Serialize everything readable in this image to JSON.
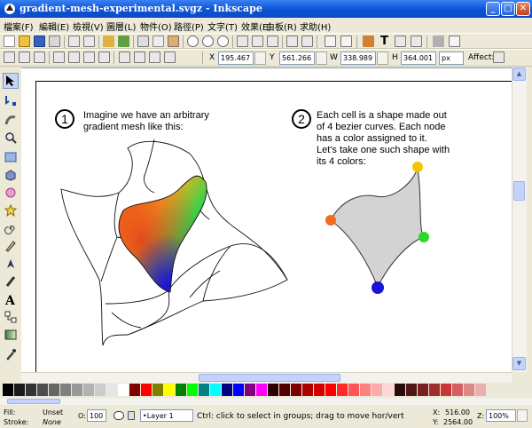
{
  "window": {
    "title": "gradient-mesh-experimental.svgz - Inkscape",
    "minimize_glyph": "_",
    "maximize_glyph": "□",
    "close_glyph": "✕"
  },
  "menu": [
    {
      "label": "檔案(F)"
    },
    {
      "label": "編輯(E)"
    },
    {
      "label": "檢視(V)"
    },
    {
      "label": "圖層(L)"
    },
    {
      "label": "物件(O)"
    },
    {
      "label": "路徑(P)"
    },
    {
      "label": "文字(T)"
    },
    {
      "label": "效果(E)"
    },
    {
      "label": "白板(R)"
    },
    {
      "label": "求助(H)"
    }
  ],
  "controls": {
    "x_label": "X",
    "x_value": "195.467",
    "y_label": "Y",
    "y_value": "561.266",
    "w_label": "W",
    "w_value": "338.989",
    "h_label": "H",
    "h_value": "364.001",
    "unit": "px",
    "affect_label": "Affect:"
  },
  "canvas": {
    "step1_number": "1",
    "step1_lines": [
      "Imagine we have an arbitrary",
      "gradient mesh like this:"
    ],
    "step2_number": "2",
    "step2_lines": [
      "Each cell is a shape made out",
      "of 4 bezier curves. Each node",
      "has a color assigned to it.",
      "Let's take one such shape with",
      "its 4 colors:"
    ],
    "node_colors": [
      "#f5c400",
      "#f26b1d",
      "#2ad82a",
      "#1a12d6"
    ]
  },
  "palette": [
    "#000000",
    "#1a1a1a",
    "#333333",
    "#4d4d4d",
    "#666666",
    "#808080",
    "#999999",
    "#b3b3b3",
    "#cccccc",
    "#e6e6e6",
    "#ffffff",
    "#800000",
    "#ff0000",
    "#808000",
    "#ffff00",
    "#008000",
    "#00ff00",
    "#008080",
    "#00ffff",
    "#000080",
    "#0000ff",
    "#800080",
    "#ff00ff",
    "#2b0000",
    "#550000",
    "#800000",
    "#aa0000",
    "#d40000",
    "#ff0000",
    "#ff2a2a",
    "#ff5555",
    "#ff8080",
    "#ffaaaa",
    "#ffd5d5",
    "#280b0b",
    "#501616",
    "#782121",
    "#a02c2c",
    "#c83737",
    "#d35f5f",
    "#de8787",
    "#e9afaf"
  ],
  "status": {
    "fill_label": "Fill:",
    "fill_value": "Unset",
    "stroke_label": "Stroke:",
    "stroke_value": "None",
    "opacity_label": "O:",
    "opacity_value": "100",
    "layer": "•Layer 1",
    "message": "Ctrl: click to select in groups; drag to move hor/vert",
    "x_label": "X:",
    "x_coord": "516.00",
    "y_label": "Y:",
    "y_coord": "2564.00",
    "zoom_label": "Z:",
    "zoom": "100%"
  }
}
